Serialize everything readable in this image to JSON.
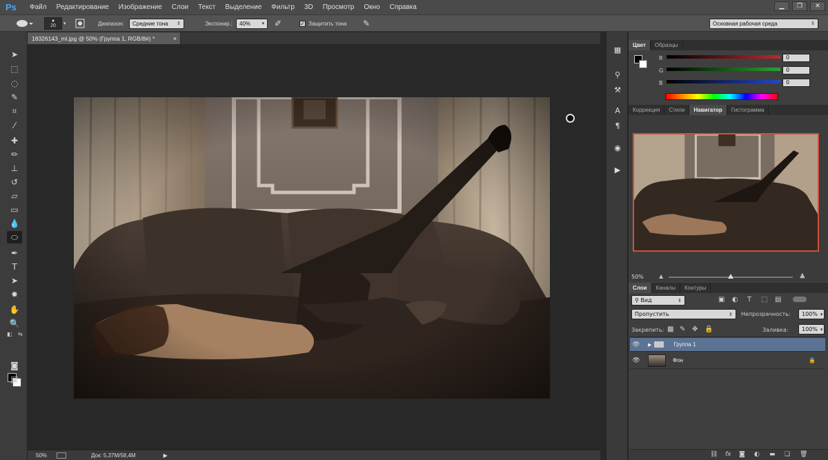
{
  "app": {
    "logo": "Ps"
  },
  "menu": [
    "Файл",
    "Редактирование",
    "Изображение",
    "Слои",
    "Текст",
    "Выделение",
    "Фильтр",
    "3D",
    "Просмотр",
    "Окно",
    "Справка"
  ],
  "options": {
    "brush_size": "20",
    "range_label": "Диапазон:",
    "range_value": "Средние тона",
    "exposure_label": "Экспонир.:",
    "exposure_value": "40%",
    "protect_label": "Защитить тона",
    "protect_checked": "✓",
    "workspace": "Основная рабочая среда"
  },
  "document": {
    "tab_title": "18326143_ml.jpg @ 50% (Группа 1, RGB/8#) *",
    "close": "×"
  },
  "statusbar": {
    "zoom": "50%",
    "doc_info": "Док: 5,37M/58,4M"
  },
  "color_panel": {
    "tabs": [
      "Цвет",
      "Образцы"
    ],
    "sliders": [
      {
        "label": "R",
        "value": "0",
        "color": "#c0282a"
      },
      {
        "label": "G",
        "value": "0",
        "color": "#2aa32f"
      },
      {
        "label": "B",
        "value": "0",
        "color": "#2448c8"
      }
    ]
  },
  "nav_panel": {
    "tabs": [
      "Коррекция",
      "Стили",
      "Навигатор",
      "Гистограмма"
    ],
    "zoom": "50%"
  },
  "layers_panel": {
    "tabs": [
      "Слои",
      "Каналы",
      "Контуры"
    ],
    "filter": "Вид",
    "blend_mode": "Пропустить",
    "opacity_label": "Непрозрачность:",
    "opacity_value": "100%",
    "lock_label": "Закрепить:",
    "fill_label": "Заливка:",
    "fill_value": "100%",
    "layers": [
      {
        "name": "Группа 1",
        "type": "group",
        "selected": true
      },
      {
        "name": "Фон",
        "type": "image",
        "locked": true
      }
    ]
  },
  "colors": {
    "accent": "#d0503f",
    "selected_layer": "#5d7394",
    "ps_blue": "#48a8ff"
  }
}
